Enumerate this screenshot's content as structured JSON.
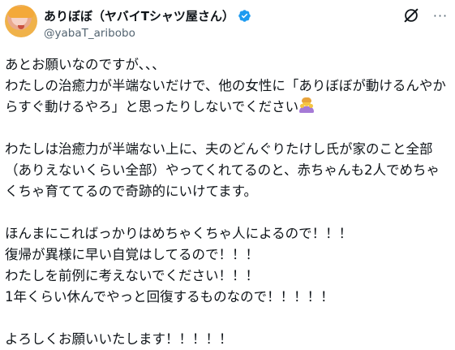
{
  "author": {
    "display_name": "ありぼぼ（ヤバイTシャツ屋さん）",
    "handle": "@yabaT_aribobo",
    "verified": true,
    "verified_color": "#1d9bf0"
  },
  "header_actions": {
    "grok_icon": "grok-icon",
    "more_icon": "more-icon",
    "more_label": "···"
  },
  "tweet": {
    "lines": [
      "あとお願いなのですが、、、",
      "わたしの治癒力が半端ないだけで、他の女性に「ありぼぼが動けるんやか",
      "らすぐ動けるやろ」と思ったりしないでください",
      "",
      "わたしは治癒力が半端ない上に、夫のどんぐりたけし氏が家のこと全部",
      "（ありえないくらい全部）やってくれてるのと、赤ちゃんも2人でめちゃ",
      "くちゃ育ててるので奇跡的にいけてます。",
      "",
      "ほんまにこればっかりはめちゃくちゃ人によるので！！！",
      "復帰が異様に早い自覚はしてるので！！！",
      "わたしを前例に考えないでください！！！",
      "1年くらい休んでやっと回復するものなので！！！！！",
      "",
      "よろしくお願いいたします！！！！！"
    ],
    "emoji_after_line_3": "person-bowing-emoji"
  }
}
